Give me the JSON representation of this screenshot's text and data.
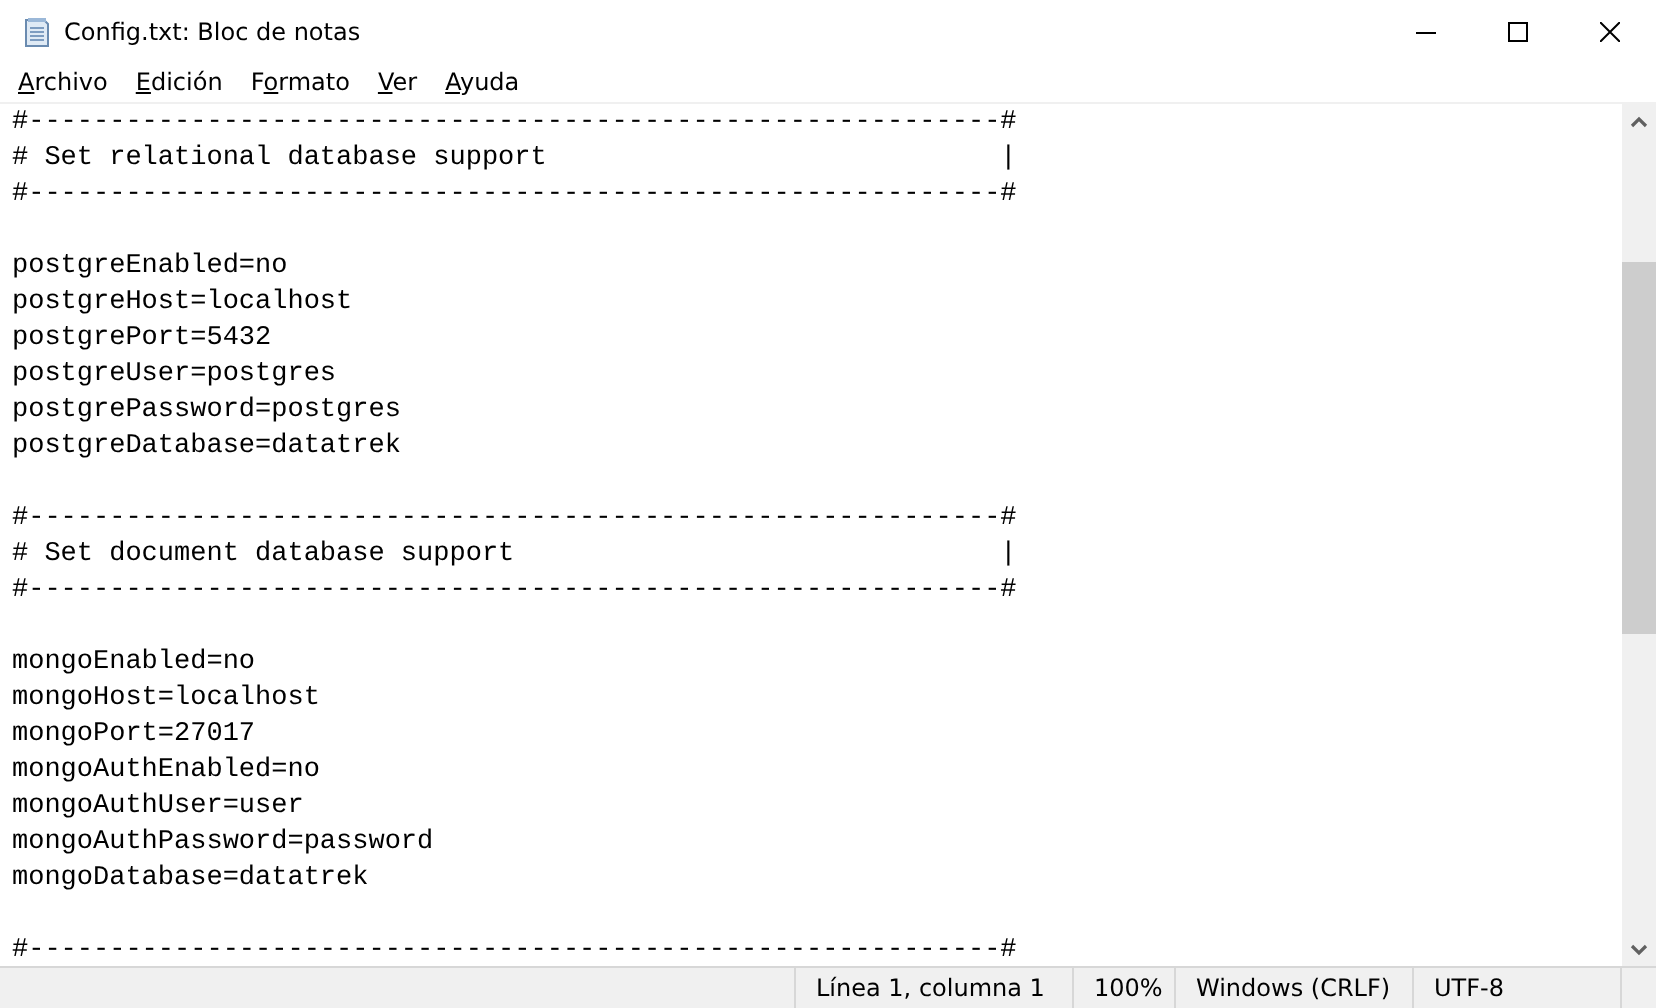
{
  "window": {
    "title": "Config.txt: Bloc de notas"
  },
  "menu": [
    {
      "access_key": "A",
      "rest": "rchivo"
    },
    {
      "access_key": "E",
      "rest": "dición"
    },
    {
      "prefix": "F",
      "access_key": "o",
      "rest": "rmato"
    },
    {
      "access_key": "V",
      "rest": "er"
    },
    {
      "access_key": "A",
      "rest": "yuda"
    }
  ],
  "editor": {
    "blocks": [
      [
        "#------------------------------------------------------------#",
        "# Set relational database support                            |",
        "#------------------------------------------------------------#"
      ],
      [
        "postgreEnabled=no",
        "postgreHost=localhost",
        "postgrePort=5432",
        "postgreUser=postgres",
        "postgrePassword=postgres",
        "postgreDatabase=datatrek"
      ],
      [
        "#------------------------------------------------------------#",
        "# Set document database support                              |",
        "#------------------------------------------------------------#"
      ],
      [
        "mongoEnabled=no",
        "mongoHost=localhost",
        "mongoPort=27017",
        "mongoAuthEnabled=no",
        "mongoAuthUser=user",
        "mongoAuthPassword=password",
        "mongoDatabase=datatrek"
      ],
      [
        "#------------------------------------------------------------#"
      ]
    ]
  },
  "status_bar": [
    "Línea 1, columna 1",
    "100%",
    "Windows (CRLF)",
    "UTF-8"
  ]
}
